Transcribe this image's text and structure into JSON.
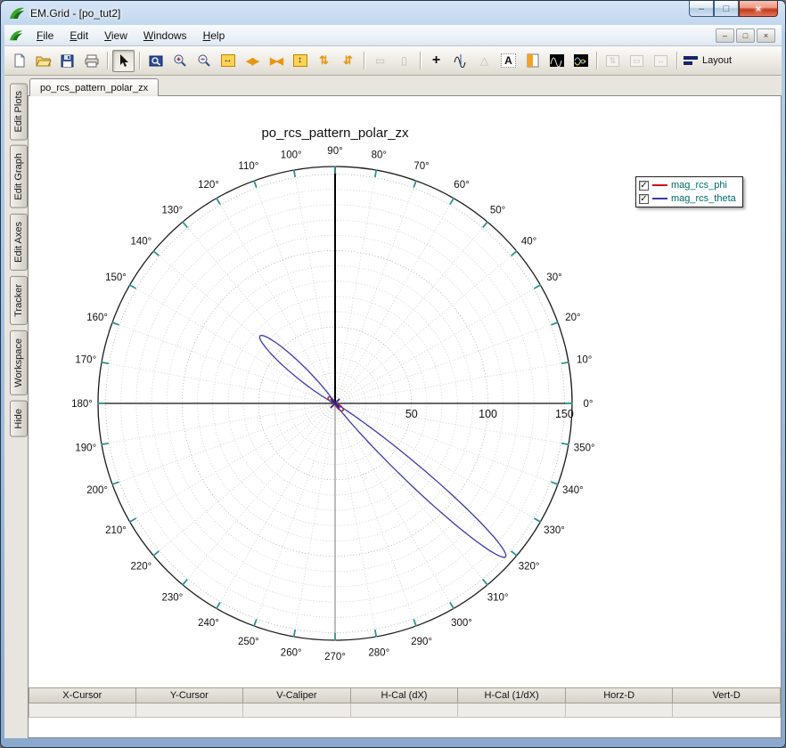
{
  "window": {
    "title": "EM.Grid - [po_tut2]"
  },
  "icons": {
    "minimize": "–",
    "maximize": "□",
    "close": "×",
    "mdi_minimize": "–",
    "mdi_restore": "□",
    "mdi_close": "×",
    "check": "✓"
  },
  "menu": {
    "items": [
      "File",
      "Edit",
      "View",
      "Windows",
      "Help"
    ]
  },
  "toolbar": {
    "buttons": [
      {
        "name": "new-file",
        "svg": "new"
      },
      {
        "name": "open-file",
        "svg": "open"
      },
      {
        "name": "save-file",
        "svg": "save"
      },
      {
        "name": "print",
        "svg": "print"
      },
      {
        "separator": true
      },
      {
        "name": "pointer-tool",
        "svg": "pointer",
        "pressed": true
      },
      {
        "separator": true
      },
      {
        "name": "zoom-window",
        "svg": "zoomwin"
      },
      {
        "name": "zoom-in",
        "svg": "zoomin"
      },
      {
        "name": "zoom-out",
        "svg": "zoomout"
      },
      {
        "name": "h-zoom",
        "glyph": "↔",
        "cls": "ybox"
      },
      {
        "name": "h-pan",
        "glyph": "◀▶",
        "cls": "oarrow"
      },
      {
        "name": "h-fit",
        "glyph": "▶◀",
        "cls": "oarrow"
      },
      {
        "name": "v-zoom",
        "glyph": "↕",
        "cls": "ybox"
      },
      {
        "name": "v-pan",
        "glyph": "⇅",
        "cls": "oarrow big"
      },
      {
        "name": "v-fit",
        "glyph": "⇵",
        "cls": "oarrow big"
      },
      {
        "separator": true
      },
      {
        "name": "region-select",
        "glyph": "▭",
        "cls": "dis"
      },
      {
        "name": "band-select",
        "glyph": "▯",
        "cls": "dis"
      },
      {
        "separator": true
      },
      {
        "name": "cross-marker",
        "glyph": "+",
        "cls": "plus"
      },
      {
        "name": "trace-tracker",
        "svg": "sine"
      },
      {
        "name": "triangle-marker",
        "glyph": "△",
        "cls": "dis"
      },
      {
        "name": "text-tool",
        "glyph": "A",
        "cls": "atool"
      },
      {
        "name": "fill-color",
        "svg": "colorpage"
      },
      {
        "name": "spectrum-1",
        "svg": "wave1"
      },
      {
        "name": "spectrum-2",
        "svg": "wave2"
      },
      {
        "separator": true
      },
      {
        "name": "v-axis-box",
        "glyph": "⇅",
        "cls": "disbox"
      },
      {
        "name": "axes-box",
        "glyph": "▭",
        "cls": "disbox"
      },
      {
        "name": "h-axis-box",
        "glyph": "↔",
        "cls": "disbox"
      },
      {
        "separator": true
      },
      {
        "name": "layout",
        "svg": "layout",
        "label": "Layout"
      }
    ]
  },
  "sidebar": {
    "tabs": [
      "Edit Plots",
      "Edit Graph",
      "Edit Axes",
      "Tracker",
      "Workspace",
      "Hide"
    ]
  },
  "document_tab": "po_rcs_pattern_polar_zx",
  "chart_data": {
    "type": "polar",
    "title": "po_rcs_pattern_polar_zx",
    "angle_step_deg": 10,
    "angle_labels": [
      "0°",
      "10°",
      "20°",
      "30°",
      "40°",
      "50°",
      "60°",
      "70°",
      "80°",
      "90°",
      "100°",
      "110°",
      "120°",
      "130°",
      "140°",
      "150°",
      "160°",
      "170°",
      "180°",
      "190°",
      "200°",
      "210°",
      "220°",
      "230°",
      "240°",
      "250°",
      "260°",
      "270°",
      "280°",
      "290°",
      "300°",
      "310°",
      "320°",
      "330°",
      "340°",
      "350°"
    ],
    "radial_ticks": [
      50,
      100,
      150
    ],
    "radial_tick_labels": [
      "50",
      "100",
      "150"
    ],
    "r_max": 155,
    "grid_r_step": 10,
    "grid_on": true,
    "grid_color": "#c4c4c4",
    "tick_color": "#2f9090",
    "legend": {
      "position": "top-right",
      "label_color": "#006b6b",
      "entries": [
        {
          "label": "mag_rcs_phi",
          "color": "#cc1111",
          "checked": true
        },
        {
          "label": "mag_rcs_theta",
          "color": "#3c3ca8",
          "checked": true
        }
      ]
    },
    "series": [
      {
        "name": "mag_rcs_phi",
        "color": "#cc1111",
        "lobes": [
          {
            "peak_deg": 318,
            "peak_r": 7,
            "sigma_deg": 25
          },
          {
            "peak_deg": 138,
            "peak_r": 6,
            "sigma_deg": 25
          }
        ]
      },
      {
        "name": "mag_rcs_theta",
        "color": "#3c3ca8",
        "lobes": [
          {
            "peak_deg": 318,
            "peak_r": 150,
            "sigma_deg": 6
          },
          {
            "peak_deg": 138,
            "peak_r": 66,
            "sigma_deg": 9
          }
        ]
      }
    ],
    "center_marker": {
      "symbol": "x",
      "color": "#26268a"
    }
  },
  "readout": {
    "columns": [
      "X-Cursor",
      "Y-Cursor",
      "V-Caliper",
      "H-Cal (dX)",
      "H-Cal (1/dX)",
      "Horz-D",
      "Vert-D"
    ],
    "values": [
      "",
      "",
      "",
      "",
      "",
      "",
      ""
    ]
  }
}
